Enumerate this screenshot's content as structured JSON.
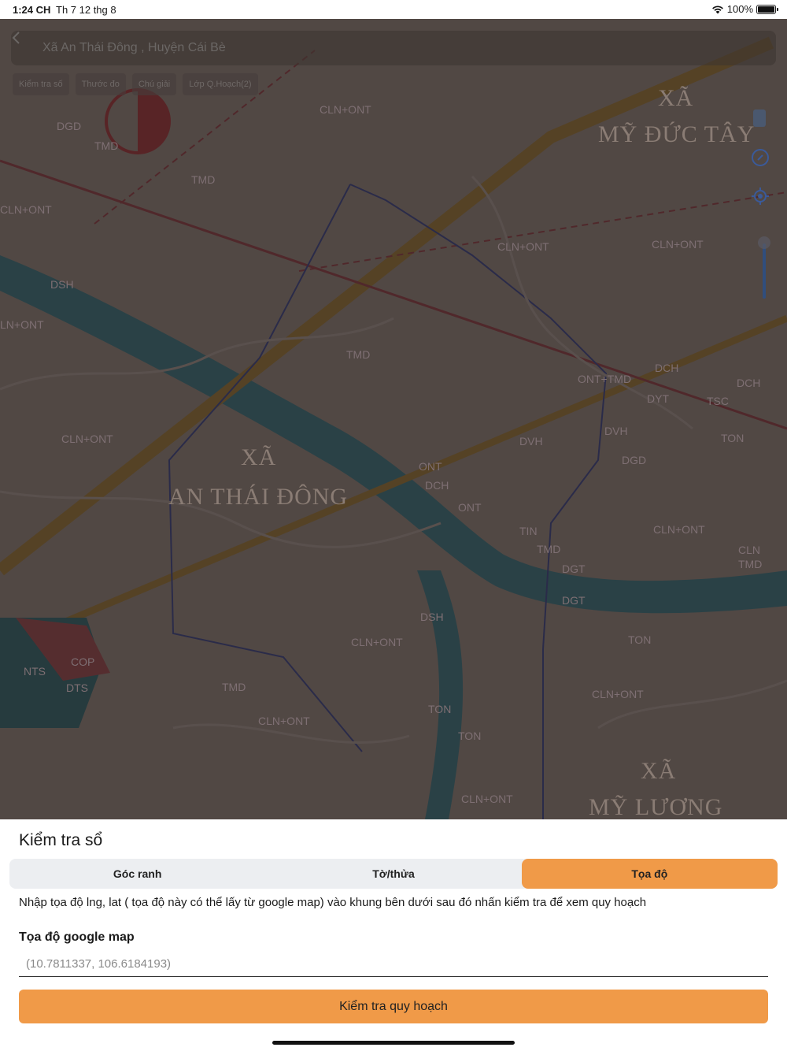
{
  "status_bar": {
    "time": "1:24 CH",
    "date": "Th 7 12 thg 8",
    "battery": "100%"
  },
  "map": {
    "title": "Xã An Thái Đông , Huyện Cái Bè",
    "chips": [
      "Kiểm tra số",
      "Thước đo",
      "Chú giải",
      "Lớp Q.Hoạch(2)"
    ],
    "place_names": [
      "XÃ",
      "MỸ ĐỨC TÂY",
      "XÃ",
      "AN THÁI ĐÔNG",
      "XÃ",
      "MỸ LƯƠNG"
    ],
    "zone_labels": [
      "CLN+ONT",
      "DGD",
      "TMD",
      "TMD",
      "CLN+ONT",
      "DSH",
      "LN+ONT",
      "CLN+ONT",
      "CLN+ONT",
      "TMD",
      "CLN+ONT",
      "DCH",
      "DCH",
      "DYT",
      "TSC",
      "DVH",
      "ONT+TMD",
      "DGD",
      "DVH",
      "TON",
      "CLN+ONT",
      "ONT",
      "DCH",
      "ONT",
      "TIN",
      "TMD",
      "DGT",
      "CLN",
      "TMD",
      "DGT",
      "DSH",
      "CLN+ONT",
      "TON",
      "NTS",
      "COP",
      "DTS",
      "TMD",
      "CLN+ONT",
      "CLN+ONT",
      "TON",
      "TON",
      "CLN+ONT"
    ]
  },
  "panel": {
    "title": "Kiểm tra sổ",
    "tabs": [
      {
        "label": "Góc ranh",
        "active": false
      },
      {
        "label": "Tờ/thửa",
        "active": false
      },
      {
        "label": "Tọa độ",
        "active": true
      }
    ],
    "instruction": "Nhập tọa độ lng, lat ( tọa độ này có thể lấy từ google map) vào khung bên dưới sau đó nhấn kiểm tra để xem quy hoạch",
    "field_label": "Tọa độ google map",
    "input_value": "",
    "input_placeholder": "(10.7811337, 106.6184193)",
    "button_label": "Kiểm tra quy hoạch"
  },
  "colors": {
    "accent": "#f09a48",
    "segment_bg": "#eceef1"
  }
}
